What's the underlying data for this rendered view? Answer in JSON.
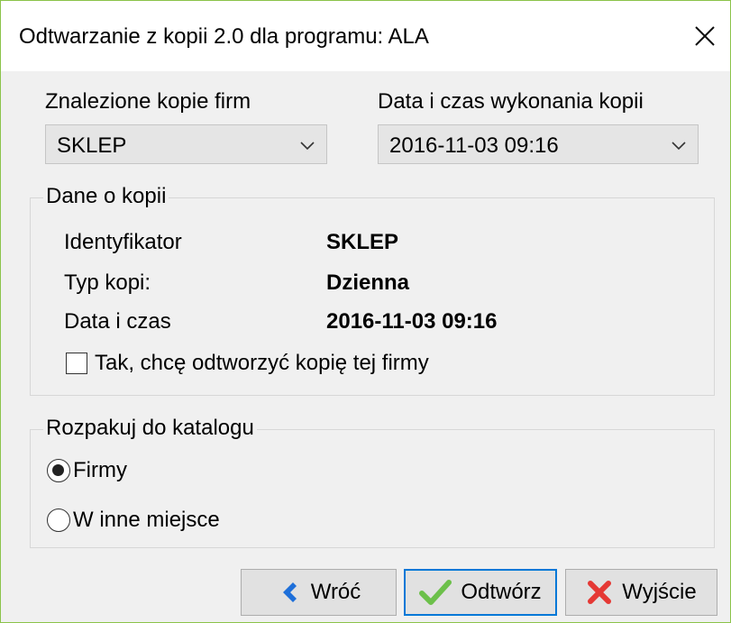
{
  "window": {
    "title": "Odtwarzanie z kopii 2.0 dla programu: ALA",
    "close_glyph": "✕"
  },
  "companies": {
    "label": "Znalezione kopie firm",
    "selected": "SKLEP"
  },
  "backup_datetime": {
    "label": "Data i czas wykonania kopii",
    "selected": "2016-11-03 09:16"
  },
  "backup_info": {
    "title": "Dane o kopii",
    "rows": [
      {
        "label": "Identyfikator",
        "value": "SKLEP"
      },
      {
        "label": "Typ kopi:",
        "value": "Dzienna"
      },
      {
        "label": "Data i czas",
        "value": "2016-11-03 09:16"
      }
    ],
    "confirm_checkbox": {
      "label": "Tak, chcę odtworzyć kopię tej firmy",
      "checked": false
    }
  },
  "extract_to": {
    "title": "Rozpakuj do katalogu",
    "options": [
      {
        "label": "Firmy",
        "selected": true
      },
      {
        "label": "W inne miejsce",
        "selected": false
      }
    ]
  },
  "buttons": {
    "back": {
      "label": "Wróć",
      "icon": "arrow-left-icon"
    },
    "open": {
      "label": "Odtwórz",
      "icon": "checkmark-icon"
    },
    "exit": {
      "label": "Wyjście",
      "icon": "x-mark-icon"
    }
  },
  "colors": {
    "window_border": "#8bc34a",
    "primary_button_border": "#0078d7",
    "back_arrow": "#1e6fd9",
    "check_green": "#6cc04a",
    "exit_red": "#e53935"
  }
}
